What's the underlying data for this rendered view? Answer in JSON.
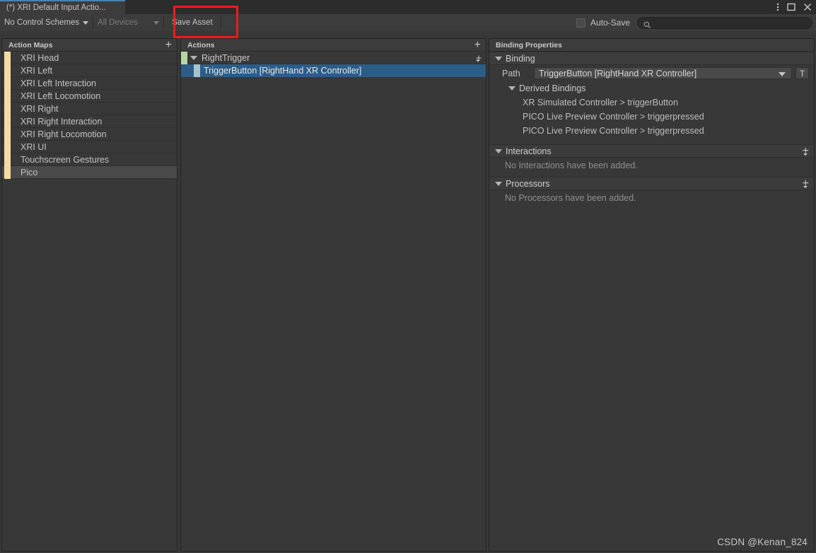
{
  "window": {
    "tab_title": "(*) XRI Default Input Actio...",
    "controls": [
      {
        "name": "more-options",
        "glyph": "⋮"
      },
      {
        "name": "maximize",
        "glyph": "☐"
      },
      {
        "name": "close",
        "glyph": "✕"
      }
    ],
    "accent_color": "#4a7fb5"
  },
  "toolbar": {
    "control_schemes_label": "No Control Schemes",
    "devices_label": "All Devices",
    "save_asset_label": "Save Asset",
    "auto_save_label": "Auto-Save",
    "auto_save_checked": false,
    "search_value": "",
    "search_placeholder": "",
    "search_icon": "search-icon",
    "highlight_color": "#ee1c1c"
  },
  "action_maps": {
    "header": "Action Maps",
    "add_label": "+",
    "bar_color": "#f2dda0",
    "items": [
      {
        "label": "XRI Head",
        "selected": false
      },
      {
        "label": "XRI Left",
        "selected": false
      },
      {
        "label": "XRI Left Interaction",
        "selected": false
      },
      {
        "label": "XRI Left Locomotion",
        "selected": false
      },
      {
        "label": "XRI Right",
        "selected": false
      },
      {
        "label": "XRI Right Interaction",
        "selected": false
      },
      {
        "label": "XRI Right Locomotion",
        "selected": false
      },
      {
        "label": "XRI UI",
        "selected": false
      },
      {
        "label": "Touchscreen Gestures",
        "selected": false
      },
      {
        "label": "Pico",
        "selected": true
      }
    ]
  },
  "actions": {
    "header": "Actions",
    "add_label": "+",
    "tree": [
      {
        "label": "RightTrigger",
        "type": "action",
        "expanded": true,
        "bar_color": "#b3d7a4",
        "selected": false,
        "add_label": "+"
      },
      {
        "label": "TriggerButton [RightHand XR Controller]",
        "type": "binding",
        "bar_color": "#a8c3cb",
        "selected": true,
        "selection_color": "#2c5d87"
      }
    ]
  },
  "binding_properties": {
    "header": "Binding Properties",
    "binding_section": {
      "title": "Binding",
      "expanded": true,
      "path_label": "Path",
      "path_value": "TriggerButton [RightHand XR Controller]",
      "path_button_label": "T",
      "derived_title": "Derived Bindings",
      "derived_expanded": true,
      "derived_items": [
        "XR Simulated Controller > triggerButton",
        "PICO Live Preview Controller > triggerpressed",
        "PICO Live Preview Controller > triggerpressed"
      ]
    },
    "interactions_section": {
      "title": "Interactions",
      "expanded": true,
      "add_label": "+",
      "empty_text": "No Interactions have been added."
    },
    "processors_section": {
      "title": "Processors",
      "expanded": true,
      "add_label": "+",
      "empty_text": "No Processors have been added."
    }
  },
  "watermark": "CSDN @Kenan_824"
}
